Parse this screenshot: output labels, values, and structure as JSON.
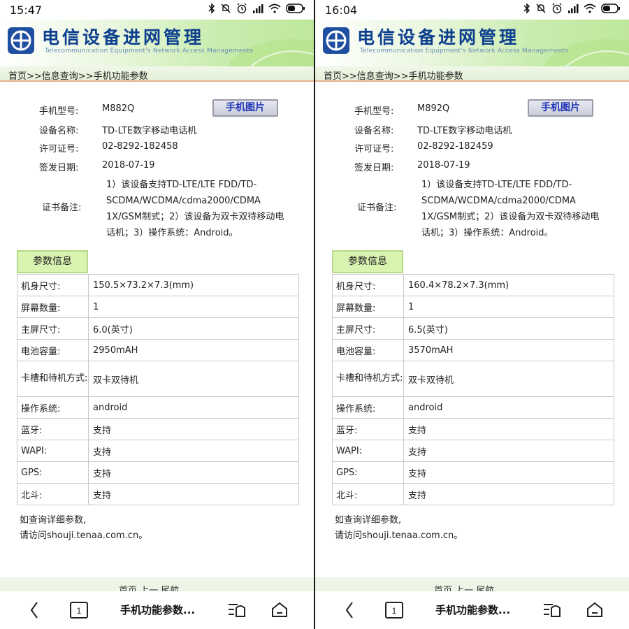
{
  "left": {
    "status": {
      "time": "15:47"
    },
    "banner": {
      "title": "电信设备进网管理",
      "subtitle": "Telecommunication Equipment's Network Access Managements"
    },
    "breadcrumb": "首页>>信息查询>>手机功能参数",
    "info": {
      "model_label": "手机型号:",
      "model": "M882Q",
      "picture_button": "手机图片",
      "name_label": "设备名称:",
      "name": "TD-LTE数字移动电话机",
      "license_label": "许可证号:",
      "license": "02-8292-182458",
      "date_label": "签发日期:",
      "date": "2018-07-19",
      "note_label": "证书备注:",
      "note": "1）该设备支持TD-LTE/LTE FDD/TD-SCDMA/WCDMA/cdma2000/CDMA 1X/GSM制式；2）该设备为双卡双待移动电话机；3）操作系统：Android。"
    },
    "params_tab": "参数信息",
    "params": [
      {
        "key": "机身尺寸:",
        "value": "150.5×73.2×7.3(mm)"
      },
      {
        "key": "屏幕数量:",
        "value": "1"
      },
      {
        "key": "主屏尺寸:",
        "value": "6.0(英寸)"
      },
      {
        "key": "电池容量:",
        "value": "2950mAH"
      },
      {
        "key": "卡槽和待机方式:",
        "value": "双卡双待机"
      },
      {
        "key": "操作系统:",
        "value": "android"
      },
      {
        "key": "蓝牙:",
        "value": "支持"
      },
      {
        "key": "WAPI:",
        "value": "支持"
      },
      {
        "key": "GPS:",
        "value": "支持"
      },
      {
        "key": "北斗:",
        "value": "支持"
      }
    ],
    "footer_line1": "如查询详细参数,",
    "footer_line2": "请访问shouji.tenaa.com.cn。",
    "pager": "首页 上一 尾航",
    "nav_title": "手机功能参数..."
  },
  "right": {
    "status": {
      "time": "16:04"
    },
    "banner": {
      "title": "电信设备进网管理",
      "subtitle": "Telecommunication Equipment's Network Access Managements"
    },
    "breadcrumb": "首页>>信息查询>>手机功能参数",
    "info": {
      "model_label": "手机型号:",
      "model": "M892Q",
      "picture_button": "手机图片",
      "name_label": "设备名称:",
      "name": "TD-LTE数字移动电话机",
      "license_label": "许可证号:",
      "license": "02-8292-182459",
      "date_label": "签发日期:",
      "date": "2018-07-19",
      "note_label": "证书备注:",
      "note": "1）该设备支持TD-LTE/LTE FDD/TD-SCDMA/WCDMA/cdma2000/CDMA 1X/GSM制式；2）该设备为双卡双待移动电话机；3）操作系统：Android。"
    },
    "params_tab": "参数信息",
    "params": [
      {
        "key": "机身尺寸:",
        "value": "160.4×78.2×7.3(mm)"
      },
      {
        "key": "屏幕数量:",
        "value": "1"
      },
      {
        "key": "主屏尺寸:",
        "value": "6.5(英寸)"
      },
      {
        "key": "电池容量:",
        "value": "3570mAH"
      },
      {
        "key": "卡槽和待机方式:",
        "value": "双卡双待机"
      },
      {
        "key": "操作系统:",
        "value": "android"
      },
      {
        "key": "蓝牙:",
        "value": "支持"
      },
      {
        "key": "WAPI:",
        "value": "支持"
      },
      {
        "key": "GPS:",
        "value": "支持"
      },
      {
        "key": "北斗:",
        "value": "支持"
      }
    ],
    "footer_line1": "如查询详细参数,",
    "footer_line2": "请访问shouji.tenaa.com.cn。",
    "pager": "首页 上一 尾航",
    "nav_title": "手机功能参数..."
  },
  "colors": {
    "banner_title": "#0d3f8f",
    "button_text": "#1f35b5",
    "tab_bg": "#d9f3b1",
    "crumb_border": "#e9b08a"
  },
  "icons": [
    "bluetooth-icon",
    "mute-icon",
    "alarm-icon",
    "signal-icon",
    "wifi-icon",
    "battery-icon",
    "back-icon",
    "tabs-icon",
    "reader-icon",
    "home-icon",
    "telecom-logo-icon"
  ]
}
